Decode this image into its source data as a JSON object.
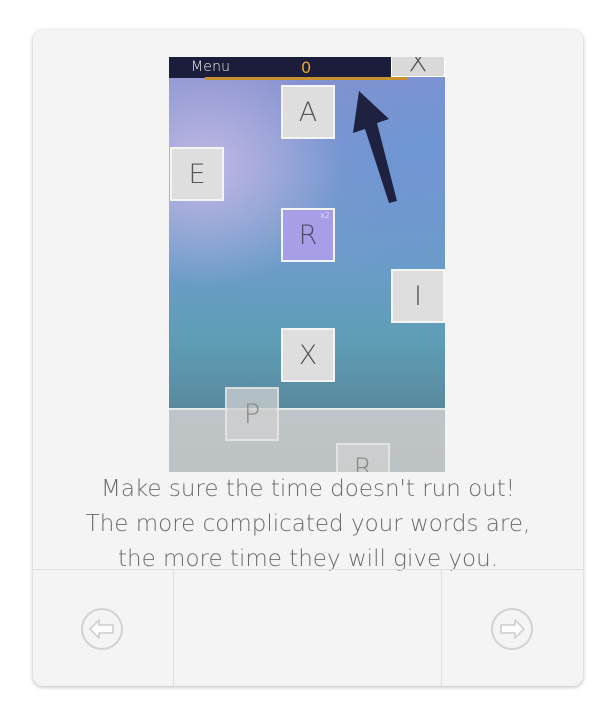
{
  "game": {
    "menu_label": "Menu",
    "score": "0",
    "corner_tile_letter": "X",
    "tiles": [
      {
        "letter": "A",
        "multiplier": ""
      },
      {
        "letter": "E",
        "multiplier": ""
      },
      {
        "letter": "R",
        "multiplier": "x2"
      },
      {
        "letter": "I",
        "multiplier": ""
      },
      {
        "letter": "X",
        "multiplier": ""
      },
      {
        "letter": "P",
        "multiplier": ""
      },
      {
        "letter": "R",
        "multiplier": ""
      }
    ],
    "colors": {
      "topbar": "#1c1d3a",
      "score": "#e6a92e",
      "timer_bar": "#c8912e",
      "selected_tile": "#a69ee6",
      "arrow": "#1e2240"
    }
  },
  "caption": {
    "line1": "Make sure the time doesn't run out!",
    "line2": "The more complicated your words are,",
    "line3": "the more time they will give you."
  },
  "nav": {
    "prev_icon": "arrow-left-circle-icon",
    "next_icon": "arrow-right-circle-icon"
  }
}
